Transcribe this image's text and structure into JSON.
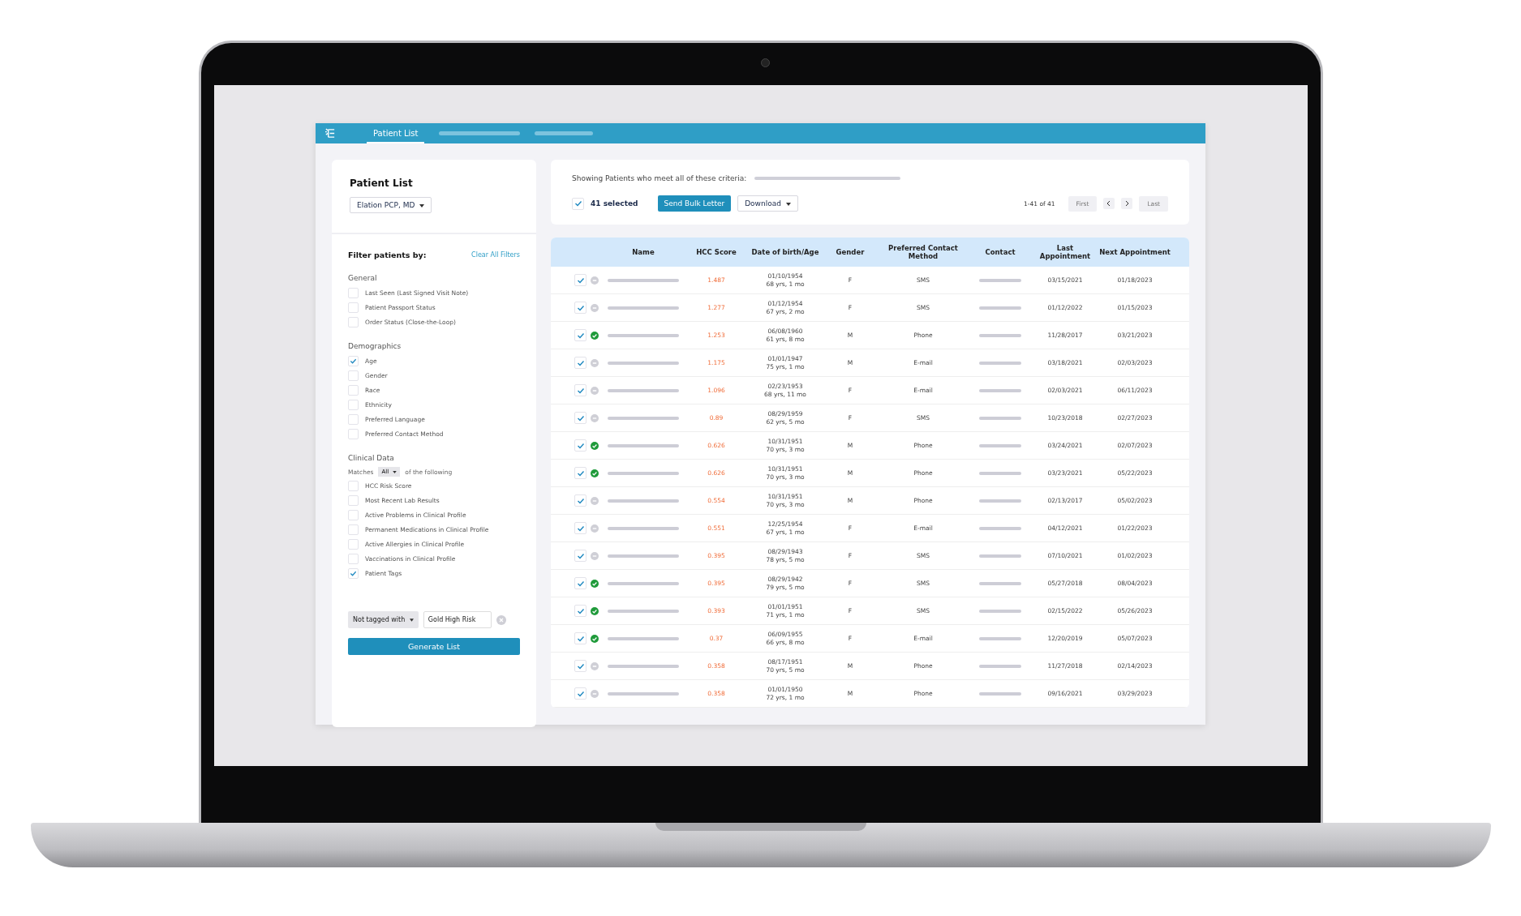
{
  "topbar": {
    "tabs": [
      {
        "label": "Patient List",
        "selected": true
      }
    ]
  },
  "sidebar": {
    "title": "Patient List",
    "provider": "Elation PCP, MD",
    "filter_title": "Filter patients by:",
    "clear_link": "Clear All Filters",
    "groups": [
      {
        "title": "General",
        "items": [
          {
            "label": "Last Seen (Last Signed Visit Note)",
            "checked": false
          },
          {
            "label": "Patient Passport Status",
            "checked": false
          },
          {
            "label": "Order Status (Close-the-Loop)",
            "checked": false
          }
        ]
      },
      {
        "title": "Demographics",
        "items": [
          {
            "label": "Age",
            "checked": true
          },
          {
            "label": "Gender",
            "checked": false
          },
          {
            "label": "Race",
            "checked": false
          },
          {
            "label": "Ethnicity",
            "checked": false
          },
          {
            "label": "Preferred Language",
            "checked": false
          },
          {
            "label": "Preferred Contact Method",
            "checked": false
          }
        ]
      },
      {
        "title": "Clinical Data",
        "matches": {
          "before": "Matches",
          "value": "All",
          "after": "of the following"
        },
        "items": [
          {
            "label": "HCC Risk Score",
            "checked": false
          },
          {
            "label": "Most Recent Lab Results",
            "checked": false
          },
          {
            "label": "Active Problems in Clinical Profile",
            "checked": false
          },
          {
            "label": "Permanent Medications in Clinical Profile",
            "checked": false
          },
          {
            "label": "Active Allergies in Clinical Profile",
            "checked": false
          },
          {
            "label": "Vaccinations in Clinical Profile",
            "checked": false
          },
          {
            "label": "Patient Tags",
            "checked": true
          }
        ]
      }
    ],
    "tag_mode": "Not tagged with",
    "tag_value": "Gold High Risk",
    "generate_button": "Generate List"
  },
  "criteria": {
    "label": "Showing Patients who meet all of these criteria:",
    "select_all_checked": true,
    "selected_count": "41 selected",
    "bulk_button": "Send Bulk Letter",
    "download_button": "Download",
    "range": "1-41 of 41",
    "first": "First",
    "last": "Last"
  },
  "table": {
    "columns": [
      "Name",
      "HCC Score",
      "Date of birth/Age",
      "Gender",
      "Preferred Contact Method",
      "Contact",
      "Last Appointment",
      "Next Appointment"
    ],
    "rows": [
      {
        "checked": true,
        "verified": false,
        "score": "1.487",
        "dob": "01/10/1954",
        "age": "68 yrs, 1 mo",
        "gender": "F",
        "method": "SMS",
        "last": "03/15/2021",
        "next": "01/18/2023"
      },
      {
        "checked": true,
        "verified": false,
        "score": "1.277",
        "dob": "01/12/1954",
        "age": "67 yrs, 2 mo",
        "gender": "F",
        "method": "SMS",
        "last": "01/12/2022",
        "next": "01/15/2023"
      },
      {
        "checked": true,
        "verified": true,
        "score": "1.253",
        "dob": "06/08/1960",
        "age": "61 yrs, 8 mo",
        "gender": "M",
        "method": "Phone",
        "last": "11/28/2017",
        "next": "03/21/2023"
      },
      {
        "checked": true,
        "verified": false,
        "score": "1.175",
        "dob": "01/01/1947",
        "age": "75 yrs, 1 mo",
        "gender": "M",
        "method": "E-mail",
        "last": "03/18/2021",
        "next": "02/03/2023"
      },
      {
        "checked": true,
        "verified": false,
        "score": "1.096",
        "dob": "02/23/1953",
        "age": "68 yrs, 11 mo",
        "gender": "F",
        "method": "E-mail",
        "last": "02/03/2021",
        "next": "06/11/2023"
      },
      {
        "checked": true,
        "verified": false,
        "score": "0.89",
        "dob": "08/29/1959",
        "age": "62 yrs, 5 mo",
        "gender": "F",
        "method": "SMS",
        "last": "10/23/2018",
        "next": "02/27/2023"
      },
      {
        "checked": true,
        "verified": true,
        "score": "0.626",
        "dob": "10/31/1951",
        "age": "70 yrs, 3 mo",
        "gender": "M",
        "method": "Phone",
        "last": "03/24/2021",
        "next": "02/07/2023"
      },
      {
        "checked": true,
        "verified": true,
        "score": "0.626",
        "dob": "10/31/1951",
        "age": "70 yrs, 3 mo",
        "gender": "M",
        "method": "Phone",
        "last": "03/23/2021",
        "next": "05/22/2023"
      },
      {
        "checked": true,
        "verified": false,
        "score": "0.554",
        "dob": "10/31/1951",
        "age": "70 yrs, 3 mo",
        "gender": "M",
        "method": "Phone",
        "last": "02/13/2017",
        "next": "05/02/2023"
      },
      {
        "checked": true,
        "verified": false,
        "score": "0.551",
        "dob": "12/25/1954",
        "age": "67 yrs, 1 mo",
        "gender": "F",
        "method": "E-mail",
        "last": "04/12/2021",
        "next": "01/22/2023"
      },
      {
        "checked": true,
        "verified": false,
        "score": "0.395",
        "dob": "08/29/1943",
        "age": "78 yrs, 5 mo",
        "gender": "F",
        "method": "SMS",
        "last": "07/10/2021",
        "next": "01/02/2023"
      },
      {
        "checked": true,
        "verified": true,
        "score": "0.395",
        "dob": "08/29/1942",
        "age": "79 yrs, 5 mo",
        "gender": "F",
        "method": "SMS",
        "last": "05/27/2018",
        "next": "08/04/2023"
      },
      {
        "checked": true,
        "verified": true,
        "score": "0.393",
        "dob": "01/01/1951",
        "age": "71 yrs, 1 mo",
        "gender": "F",
        "method": "SMS",
        "last": "02/15/2022",
        "next": "05/26/2023"
      },
      {
        "checked": true,
        "verified": true,
        "score": "0.37",
        "dob": "06/09/1955",
        "age": "66 yrs, 8 mo",
        "gender": "F",
        "method": "E-mail",
        "last": "12/20/2019",
        "next": "05/07/2023"
      },
      {
        "checked": true,
        "verified": false,
        "score": "0.358",
        "dob": "08/17/1951",
        "age": "70 yrs, 5 mo",
        "gender": "M",
        "method": "Phone",
        "last": "11/27/2018",
        "next": "02/14/2023"
      },
      {
        "checked": true,
        "verified": false,
        "score": "0.358",
        "dob": "01/01/1950",
        "age": "72 yrs, 1 mo",
        "gender": "M",
        "method": "Phone",
        "last": "09/16/2021",
        "next": "03/29/2023"
      }
    ]
  }
}
